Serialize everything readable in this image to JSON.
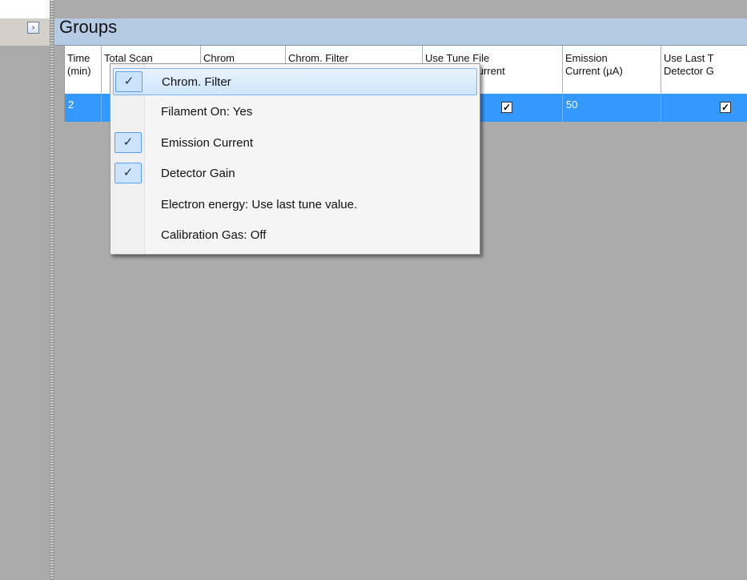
{
  "panel": {
    "title": "Groups",
    "expand_icon": "chevron-right-icon"
  },
  "grid": {
    "columns": [
      "Time\n(min)",
      "Total Scan",
      "Chrom",
      "Chrom. Filter",
      "Use Tune File\nEmission Current",
      "Emission\nCurrent (µA)",
      "Use Last T\nDetector G"
    ],
    "row": {
      "time": "2",
      "use_tune_file_checked": true,
      "emission_current": "50",
      "use_last_checked": true
    }
  },
  "context_menu": {
    "items": [
      {
        "label": "Chrom. Filter",
        "checked": true,
        "highlighted": true
      },
      {
        "label": "Filament On: Yes",
        "checked": false
      },
      {
        "label": "Emission Current",
        "checked": true
      },
      {
        "label": "Detector Gain",
        "checked": true
      },
      {
        "label": "Electron energy: Use last tune value.",
        "checked": false
      },
      {
        "label": "Calibration Gas: Off",
        "checked": false
      }
    ],
    "check_glyph": "✓"
  },
  "colors": {
    "selection": "#3399ff",
    "header": "#b5cbe3",
    "background": "#ababab"
  }
}
